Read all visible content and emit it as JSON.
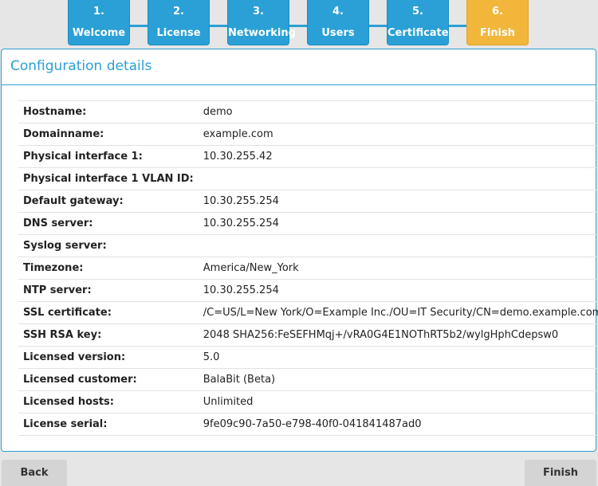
{
  "wizard": {
    "steps": [
      {
        "number": "1.",
        "label": "Welcome"
      },
      {
        "number": "2.",
        "label": "License"
      },
      {
        "number": "3.",
        "label": "Networking"
      },
      {
        "number": "4.",
        "label": "Users"
      },
      {
        "number": "5.",
        "label": "Certificate"
      },
      {
        "number": "6.",
        "label": "Finish"
      }
    ],
    "active_step": 6,
    "colors": {
      "step": "#2aa0d6",
      "active": "#f2b63a"
    }
  },
  "panel": {
    "title": "Configuration details",
    "rows": [
      {
        "label": "Hostname:",
        "value": "demo"
      },
      {
        "label": "Domainname:",
        "value": "example.com"
      },
      {
        "label": "Physical interface 1:",
        "value": "10.30.255.42"
      },
      {
        "label": "Physical interface 1 VLAN ID:",
        "value": ""
      },
      {
        "label": "Default gateway:",
        "value": "10.30.255.254"
      },
      {
        "label": "DNS server:",
        "value": "10.30.255.254"
      },
      {
        "label": "Syslog server:",
        "value": ""
      },
      {
        "label": "Timezone:",
        "value": "America/New_York"
      },
      {
        "label": "NTP server:",
        "value": "10.30.255.254"
      },
      {
        "label": "SSL certificate:",
        "value": "/C=US/L=New York/O=Example Inc./OU=IT Security/CN=demo.example.com"
      },
      {
        "label": "SSH RSA key:",
        "value": "2048 SHA256:FeSEFHMqj+/vRA0G4E1NOThRT5b2/wylgHphCdepsw0"
      },
      {
        "label": "Licensed version:",
        "value": "5.0"
      },
      {
        "label": "Licensed customer:",
        "value": "BalaBit (Beta)"
      },
      {
        "label": "Licensed hosts:",
        "value": "Unlimited"
      },
      {
        "label": "License serial:",
        "value": "9fe09c90-7a50-e798-40f0-041841487ad0"
      }
    ]
  },
  "footer": {
    "back_label": "Back",
    "finish_label": "Finish"
  }
}
